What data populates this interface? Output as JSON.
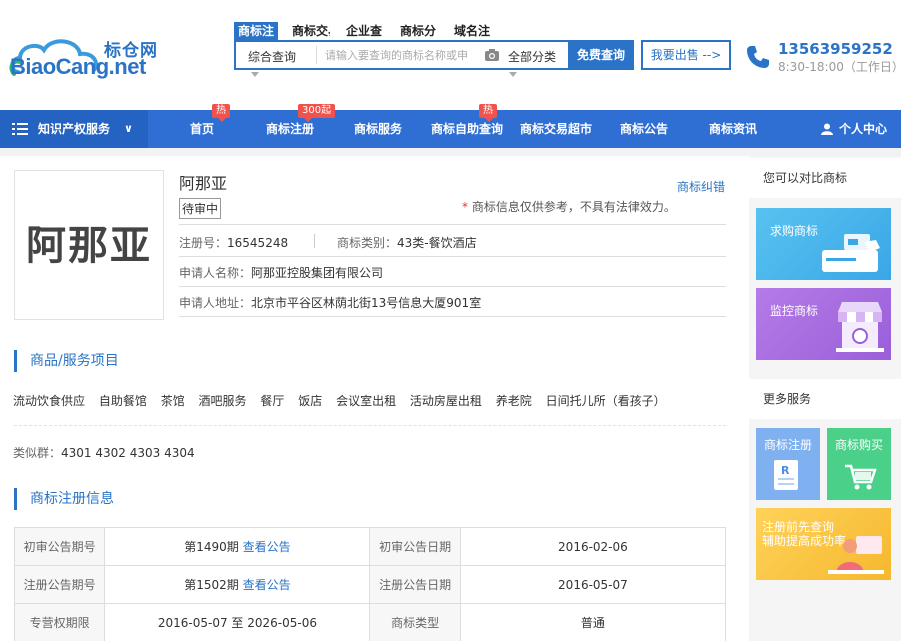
{
  "logo": {
    "cn": "标仓网",
    "en": "BiaoCang.net"
  },
  "search": {
    "tabs": [
      "商标注",
      "商标交易",
      "企业查",
      "商标分",
      "域名注"
    ],
    "type_select": "综合查询",
    "placeholder": "请输入要查询的商标名称或申",
    "category": "全部分类",
    "button": "免费查询"
  },
  "sell_button": "我要出售 -->",
  "contact": {
    "phone": "13563959252",
    "hours": "8:30-18:00（工作日）"
  },
  "colors": {
    "primary": "#2a73c6",
    "nav": "#2f6fd4",
    "badge": "#f0524c"
  },
  "nav": {
    "category": "知识产权服务",
    "items": [
      {
        "label": "首页",
        "badge": "热"
      },
      {
        "label": "商标注册",
        "badge": "300起"
      },
      {
        "label": "商标服务",
        "badge": ""
      },
      {
        "label": "商标自助查询",
        "badge": "热"
      },
      {
        "label": "商标交易超市",
        "badge": ""
      },
      {
        "label": "商标公告",
        "badge": ""
      },
      {
        "label": "商标资讯",
        "badge": ""
      }
    ],
    "user": "个人中心"
  },
  "trademark": {
    "image_text": "阿那亚",
    "name": "阿那亚",
    "status": "待审中",
    "correct_link": "商标纠错",
    "disclaimer": "商标信息仅供参考，不具有法律效力。",
    "reg_no_label": "注册号：",
    "reg_no": "16545248",
    "class_label": "商标类别：",
    "class": "43类-餐饮酒店",
    "applicant_label": "申请人名称：",
    "applicant": "阿那亚控股集团有限公司",
    "address_label": "申请人地址：",
    "address": "北京市平谷区林荫北街13号信息大厦901室"
  },
  "goods": {
    "title": "商品/服务项目",
    "items": [
      "流动饮食供应",
      "自助餐馆",
      "茶馆",
      "酒吧服务",
      "餐厅",
      "饭店",
      "会议室出租",
      "活动房屋出租",
      "养老院",
      "日间托儿所（看孩子）"
    ],
    "similar_label": "类似群：",
    "similar": "4301 4302 4303 4304"
  },
  "registration": {
    "title": "商标注册信息",
    "rows": [
      {
        "l1": "初审公告期号",
        "v1": "第1490期",
        "link1": "查看公告",
        "l2": "初审公告日期",
        "v2": "2016-02-06"
      },
      {
        "l1": "注册公告期号",
        "v1": "第1502期",
        "link1": "查看公告",
        "l2": "注册公告日期",
        "v2": "2016-05-07"
      },
      {
        "l1": "专营权期限",
        "v1": "2016-05-07 至 2026-05-06",
        "link1": "",
        "l2": "商标类型",
        "v2": "普通"
      }
    ]
  },
  "sidebar": {
    "compare_title": "您可以对比商标",
    "buy": "求购商标",
    "monitor": "监控商标",
    "more_title": "更多服务",
    "register": "商标注册",
    "purchase": "商标购买",
    "pre_query": "注册前先查询\n辅助提高成功率"
  }
}
